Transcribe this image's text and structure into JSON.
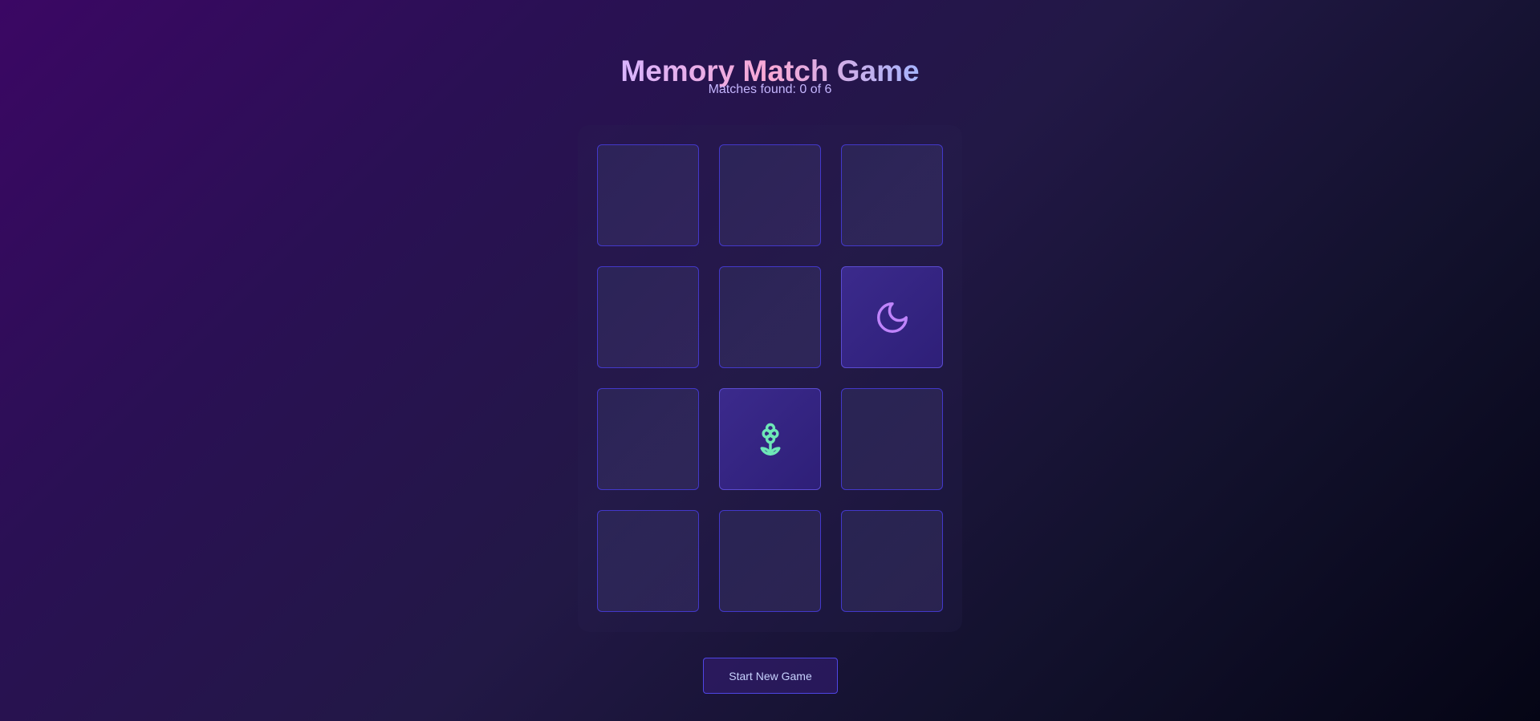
{
  "game": {
    "title": "Memory Match Game",
    "status": "Matches found: 0 of 6",
    "new_game_label": "Start New Game",
    "matches_found": 0,
    "total_pairs": 6
  },
  "cards": [
    {
      "position": 1,
      "state": "face-down",
      "icon": null
    },
    {
      "position": 2,
      "state": "face-down",
      "icon": null
    },
    {
      "position": 3,
      "state": "face-down",
      "icon": null
    },
    {
      "position": 4,
      "state": "face-down",
      "icon": null
    },
    {
      "position": 5,
      "state": "face-down",
      "icon": null
    },
    {
      "position": 6,
      "state": "face-up",
      "icon": "moon-icon",
      "icon_color": "#c084fc"
    },
    {
      "position": 7,
      "state": "face-down",
      "icon": null
    },
    {
      "position": 8,
      "state": "face-up",
      "icon": "flower-icon",
      "icon_color": "#6ee7b7"
    },
    {
      "position": 9,
      "state": "face-down",
      "icon": null
    },
    {
      "position": 10,
      "state": "face-down",
      "icon": null
    },
    {
      "position": 11,
      "state": "face-down",
      "icon": null
    },
    {
      "position": 12,
      "state": "face-down",
      "icon": null
    }
  ],
  "colors": {
    "title_gradient": [
      "#d8b4fe",
      "#f9a8d4",
      "#a5b4fc"
    ],
    "status_text": "#c4b5fd",
    "card_border": "#4338ca",
    "card_face_up": "#3b2a8c",
    "button_border": "#4f46e5"
  }
}
